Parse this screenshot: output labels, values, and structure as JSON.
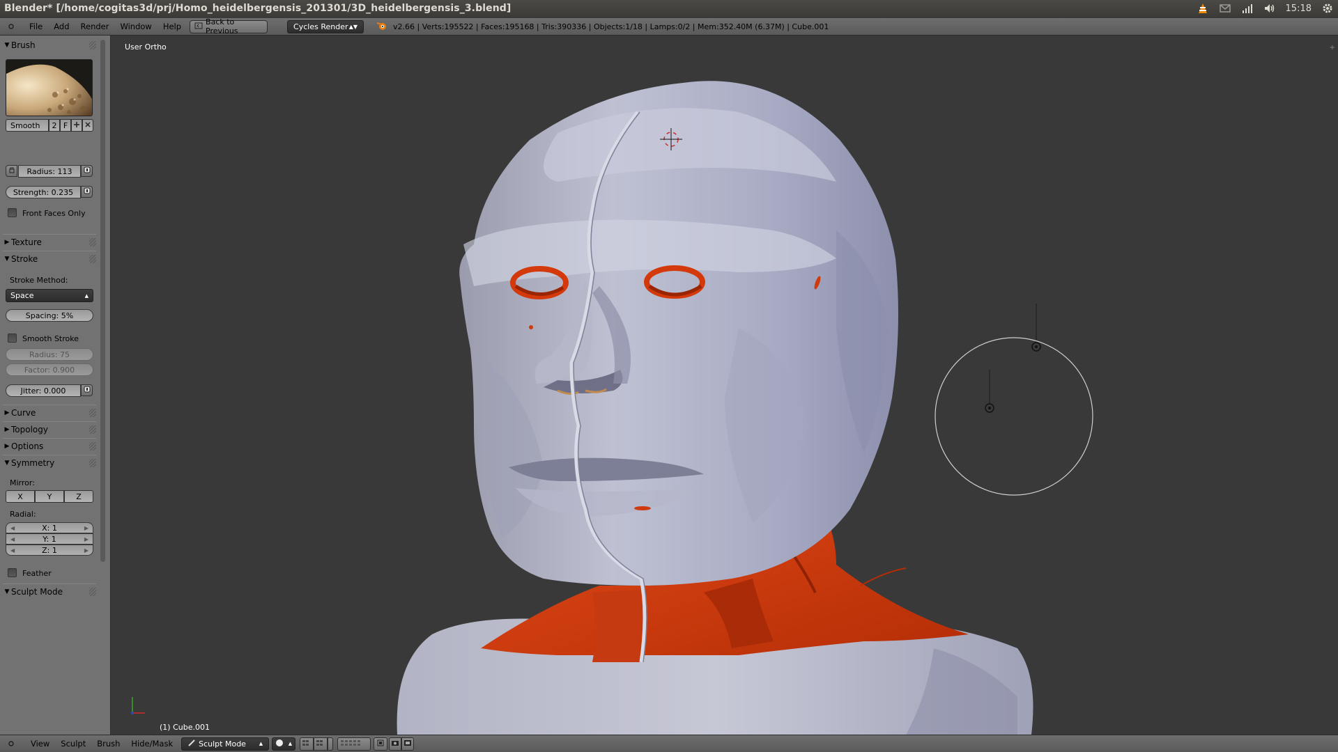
{
  "os_bar": {
    "title": "Blender* [/home/cogitas3d/prj/Homo_heidelbergensis_201301/3D_heidelbergensis_3.blend]",
    "clock": "15:18",
    "tray_icons": [
      "vlc-icon",
      "mail-icon",
      "network-icon",
      "volume-icon",
      "gear-icon"
    ]
  },
  "header": {
    "menus": [
      "File",
      "Add",
      "Render",
      "Window",
      "Help"
    ],
    "back_button": "Back to Previous",
    "render_engine": "Cycles Render",
    "stats": "v2.66 | Verts:195522 | Faces:195168 | Tris:390336 | Objects:1/18 | Lamps:0/2 | Mem:352.40M (6.37M) | Cube.001"
  },
  "toolshelf": {
    "brush_panel": "Brush",
    "brush_name": "Smooth",
    "brush_users": "2",
    "brush_fake": "F",
    "radius": "Radius: 113",
    "strength": "Strength: 0.235",
    "front_faces": "Front Faces Only",
    "texture_panel": "Texture",
    "stroke_panel": "Stroke",
    "stroke_method_label": "Stroke Method:",
    "stroke_method": "Space",
    "spacing": "Spacing: 5%",
    "smooth_stroke": "Smooth Stroke",
    "ss_radius": "Radius: 75",
    "ss_factor": "Factor: 0.900",
    "jitter": "Jitter: 0.000",
    "curve_panel": "Curve",
    "topology_panel": "Topology",
    "options_panel": "Options",
    "symmetry_panel": "Symmetry",
    "mirror_label": "Mirror:",
    "mirror": [
      "X",
      "Y",
      "Z"
    ],
    "radial_label": "Radial:",
    "radial": [
      "X: 1",
      "Y: 1",
      "Z: 1"
    ],
    "feather": "Feather",
    "sculpt_mode_panel": "Sculpt Mode"
  },
  "viewport": {
    "view_name": "User Ortho",
    "object_name": "(1) Cube.001",
    "colors": {
      "skin": "#a4a7bd",
      "muscle": "#cf3a0f",
      "background": "#393939"
    }
  },
  "footer": {
    "menus": [
      "View",
      "Sculpt",
      "Brush",
      "Hide/Mask"
    ],
    "mode": "Sculpt Mode"
  }
}
